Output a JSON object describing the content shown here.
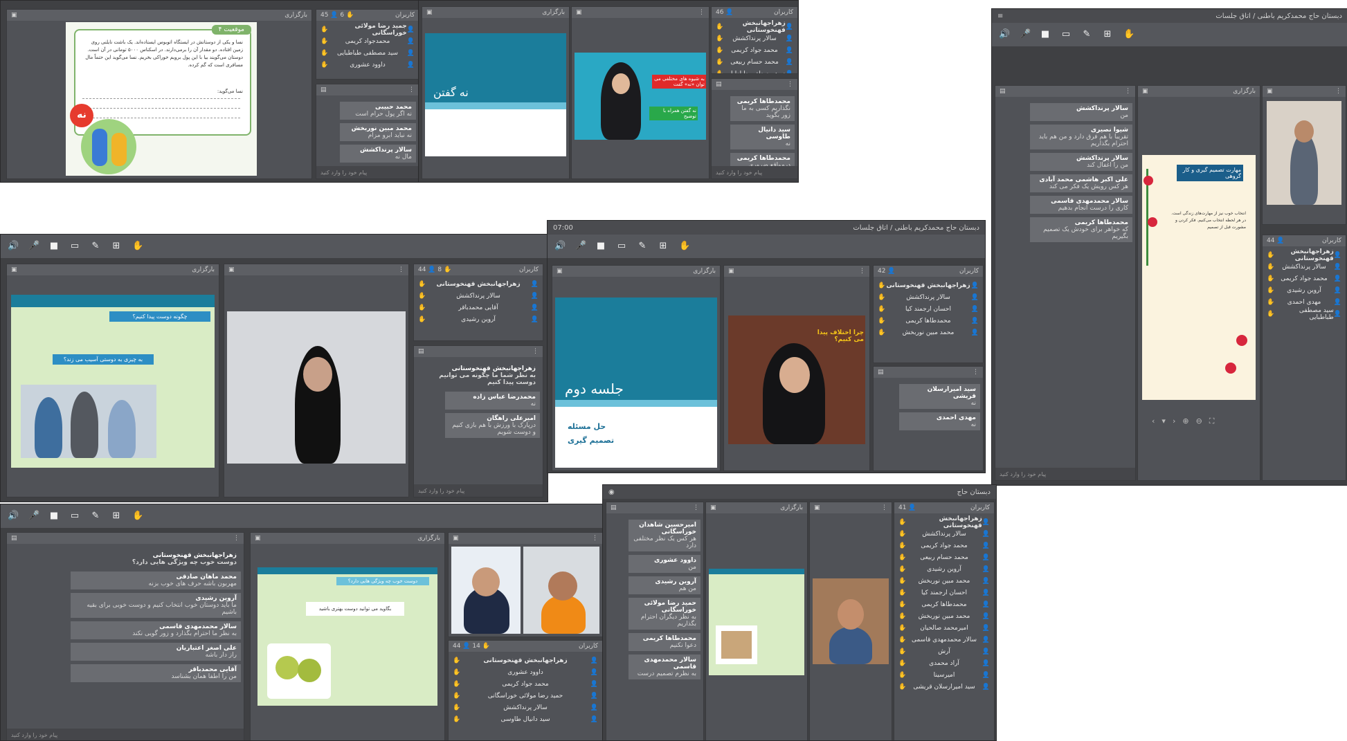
{
  "toolbar_icons": [
    "speaker-icon",
    "mic-icon",
    "camera-icon",
    "screen-icon",
    "pen-icon",
    "add-icon",
    "hand-icon"
  ],
  "headers": {
    "presentation": "بارگزاری",
    "users": "کاربران",
    "counts_a": "45",
    "counts_b": "6",
    "counts_c": "46",
    "counts_d": "44",
    "counts_e": "8",
    "counts_f": "42",
    "counts_g": "41",
    "counts_h": "14",
    "timer": "07:00"
  },
  "window_titles": {
    "mid_right": "دبستان حاج محمدکریم باطنی / اتاق جلسات",
    "top_right": "دبستان حاج محمدکریم باطنی / اتاق جلسات",
    "bottom_mid": "دبستان حاج"
  },
  "slides": {
    "book_heading": "موقعیت ۴",
    "book_text": "نسا و یکی از دوستانش در ایستگاه اتوبوس ایستاده‌اند. یک باشت نایلنی روی زمین افتاده. دو مقدار آن را برمی‌دارند. در اسکناس ۵۰۰۰ تومانی در آن است. دوستان می‌گویند بیا با این پول برویم خوراکی بخریم. نسا می‌گوید این حتماً مال مسافری است که گم کرده.",
    "book_prompt": "نسا می‌گوید:",
    "no_badge": "نه",
    "say_no": "نه گفتن",
    "video_banner1": "به شیوه های مختلفی می توان «نه» گفت",
    "video_banner2": "نه گفتن همراه با توضیح",
    "friend_q": "چگونه دوست پیدا کنیم؟",
    "friend_q2": "به چیزی به دوستی آسیب می زند؟",
    "session_two": "جلسه دوم",
    "problem_solving": "حل مسئله",
    "decision": "تصمیم گیری",
    "video_question": "چرا اختلاف پیدا می کنیم؟",
    "decision_title": "مهارت تصمیم گیری و کار گروهی",
    "decision_text": "انتخاب خوب نیز از مهارت‌های زندگی است. در هر لحظه انتخاب می‌کنیم. فکر کردن و مشورت قبل از تصمیم",
    "good_friend": "دوست خوب چه ویژگی هایی دارد؟",
    "friend_card": "بگاوید می توانید دوست بهتری باشید"
  },
  "users_top_left": [
    "جمید رضا مولائی خوراسگانی",
    "محمدجواد کریمی",
    "سید مصطفی طباطبایی",
    "داوود عشوری"
  ],
  "users_top_center": [
    "زهراجهانبخش قهنخوستانی",
    "سالار پرنداکشش",
    "محمد جواد کریمی",
    "محمد حسام ربیعی",
    "سید مصطفی طباطبایی"
  ],
  "users_mid_left": [
    "زهراجهانبخش قهنخوستانی",
    "سالار پرنداکشش",
    "آقایی محمدباقر",
    "آروین رشیدی"
  ],
  "users_mid_center": [
    "زهراجهانبخش قهنخوستانی",
    "سالار پرنداکشش",
    "احسان ارجمند کیا",
    "محمدطاها کریمی",
    "محمد مبین نوربخش"
  ],
  "users_right": [
    "زهراجهانبخش قهنخوستانی",
    "سالار پرنداکشش",
    "محمد جواد کریمی",
    "آروین رشیدی",
    "مهدی احمدی",
    "سید مصطفی طباطبایی"
  ],
  "users_bottom_right": [
    "زهراجهانبخش قهنخوستانی",
    "سالار پرنداکشش",
    "محمد جواد کریمی",
    "محمد حسام ربیعی",
    "آروین رشیدی",
    "محمد مبین نوربخش",
    "احسان ارجمند کیا",
    "محمدطاها کریمی",
    "محمد مبین نوربخش",
    "امیرمحمد صالحیان",
    "سالار محمدمهدی قاسمی",
    "آرش",
    "آراد محمدی",
    "امیرسینا",
    "سید امیرارسلان قریشی"
  ],
  "users_bottom_center": [
    "زهراجهانبخش قهنخوستانی",
    "داوود عشوری",
    "محمد جواد کریمی",
    "حمید رضا مولائی خوراسگانی",
    "سالار پرنداکشش",
    "سید دانیال طاوسی"
  ],
  "chat_top_left": [
    {
      "name": "محمد حبیبی",
      "text": "نه اگر پول حرام است"
    },
    {
      "name": "محمد مبین نوربخش",
      "text": "نه نباید ابرو مزام"
    },
    {
      "name": "سالار پرنداکشش",
      "text": "مال نه"
    }
  ],
  "chat_top_center": [
    {
      "name": "محمدطاها کریمی",
      "text": "نگذاریم کسی به ما زور بگوید"
    },
    {
      "name": "سید دانیال طاوسی",
      "text": "نه"
    },
    {
      "name": "محمدطاها کریمی",
      "text": "درمواقع ضروری نتوانیم نه بگوییم"
    }
  ],
  "chat_mid_left": [
    {
      "name": "زهراجهانبخش قهنخوستانی",
      "text": "به نظر شما ما چگونه می توانیم دوست پیدا کنیم",
      "hl": true
    },
    {
      "name": "محمدرضا عباس زاده",
      "text": "نه"
    },
    {
      "name": "امیرعلی راهگان",
      "text": "درپارک با ورزش با هم بازی کنیم و دوست شویم"
    }
  ],
  "chat_mid_center": [
    {
      "name": "سید امیرارسلان قریشی",
      "text": "نه"
    },
    {
      "name": "مهدی احمدی",
      "text": "نه"
    }
  ],
  "chat_right": [
    {
      "name": "سالار پرنداکشش",
      "text": "من"
    },
    {
      "name": "شیوا نصیری",
      "text": "تقریبا با هم فرق دارد و من هم باید احترام بگذاریم"
    },
    {
      "name": "سالار پرنداکشش",
      "text": "من را اغفال کند"
    },
    {
      "name": "علی اکبر هاشمی محمد آبادی",
      "text": "هر کس رویش یک فکر می کند"
    },
    {
      "name": "سالار محمدمهدی قاسمی",
      "text": "کاری را درست انجام بدهیم"
    },
    {
      "name": "محمدطاها کریمی",
      "text": "که خواهر برای خودش یک تصمیم بگیریم"
    }
  ],
  "chat_bottom_left": [
    {
      "name": "زهراجهانبخش قهنخوستانی",
      "text": "دوست خوب چه ویژگی هایی دارد؟",
      "hl": true
    },
    {
      "name": "محمد ماهان صادقی",
      "text": "مهربون باشه حرف های خوب بزنه"
    },
    {
      "name": "آروین رشیدی",
      "text": "ما باید دوستان خوب انتخاب کنیم و دوست خوبی برای بقیه باشیم"
    },
    {
      "name": "سالار محمدمهدی قاسمی",
      "text": "به نظر ما احترام بگذارد و زور گویی نکند"
    },
    {
      "name": "علی اصغر اعتباریان",
      "text": "راز دار باشه"
    },
    {
      "name": "آقایی محمدباقر",
      "text": "من را اطفا همان بشناسد"
    }
  ],
  "chat_bottom_mid": [
    {
      "name": "امیرحسین شاهدان خوراسگانی",
      "text": "هر کس یک نظر مختلفی دارد"
    },
    {
      "name": "داوود عشوری",
      "text": "من"
    },
    {
      "name": "آروین رشیدی",
      "text": "من هم"
    },
    {
      "name": "حمید رضا مولائی خوراسگانی",
      "text": "به نظر دیگران احترام بگذاریم"
    },
    {
      "name": "محمدطاها کریمی",
      "text": "دعوا نکنیم"
    },
    {
      "name": "سالار محمدمهدی قاسمی",
      "text": "به نظرم تصمیم درست"
    }
  ],
  "input_placeholder": "پیام خود را وارد کنید",
  "colors": {
    "accent_yellow": "#f1c40f",
    "slide_teal": "#1b7d9b",
    "slide_green": "#d9ecc5",
    "hilite": "#f39c12"
  }
}
